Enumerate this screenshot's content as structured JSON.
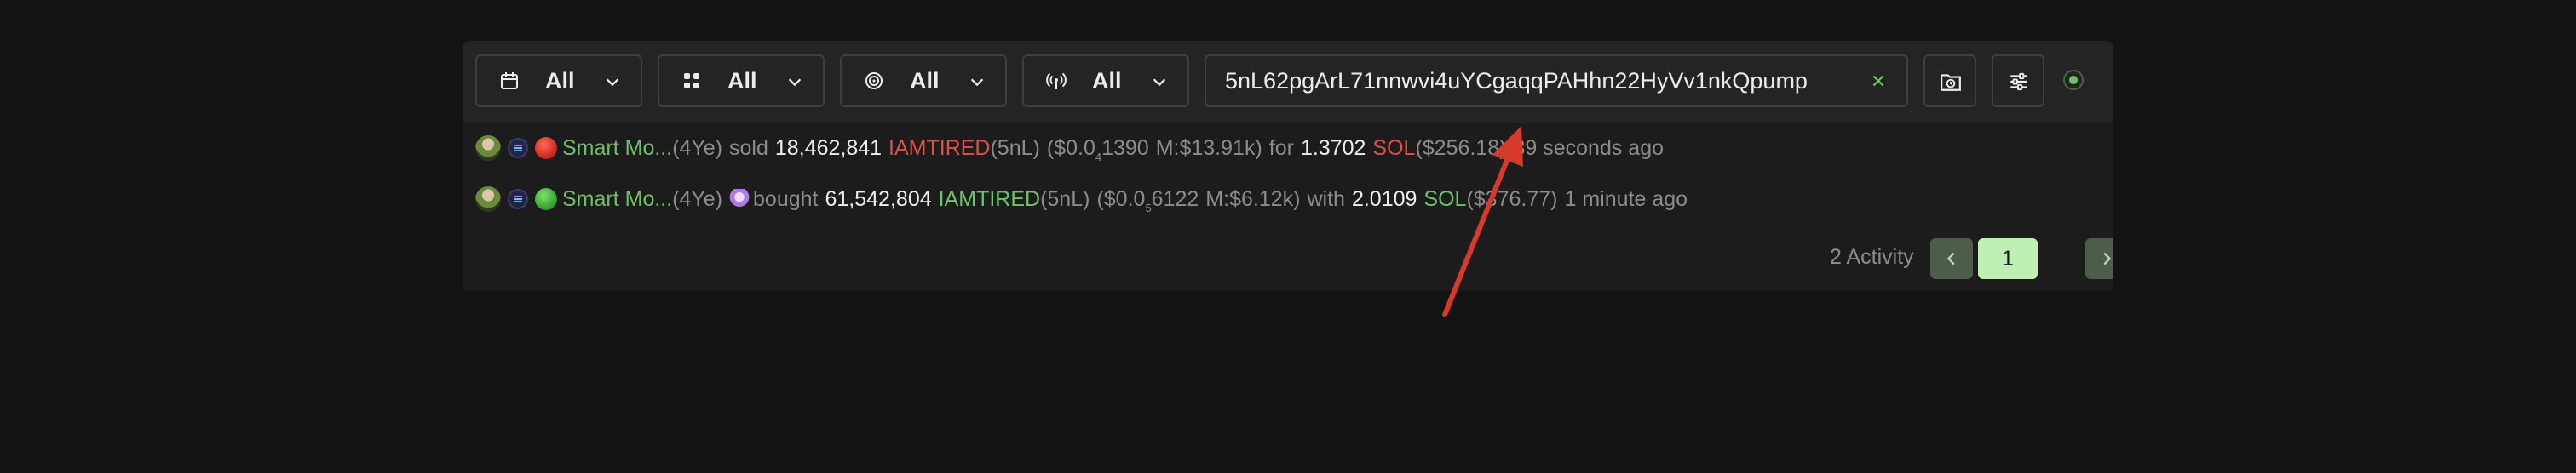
{
  "filters": [
    {
      "icon": "calendar-icon",
      "label": "All"
    },
    {
      "icon": "grid-icon",
      "label": "All"
    },
    {
      "icon": "target-icon",
      "label": "All"
    },
    {
      "icon": "broadcast-icon",
      "label": "All"
    }
  ],
  "search": {
    "value": "5nL62pgArL71nnwvi4uYCgaqqPAHhn22HyVv1nkQpump"
  },
  "activities": [
    {
      "side": "sold",
      "wallet_name": "Smart Mo...",
      "wallet_short": "(4Ye)",
      "action": "sold",
      "amount": "18,462,841",
      "token": "IAMTIRED",
      "token_short": "(5nL)",
      "price_prefix": "($0.0",
      "price_zeros": "4",
      "price_digits": "1390",
      "mcap": "M:$13.91k)",
      "preposition": "for",
      "sol_amount": "1.3702",
      "sol_label": "SOL",
      "usd_value": "($256.18)",
      "time_ago": "39 seconds ago"
    },
    {
      "side": "bought",
      "wallet_name": "Smart Mo...",
      "wallet_short": "(4Ye)",
      "action": "bought",
      "amount": "61,542,804",
      "token": "IAMTIRED",
      "token_short": "(5nL)",
      "price_prefix": "($0.0",
      "price_zeros": "5",
      "price_digits": "6122",
      "mcap": "M:$6.12k)",
      "preposition": "with",
      "sol_amount": "2.0109",
      "sol_label": "SOL",
      "usd_value": "($376.77)",
      "time_ago": "1 minute ago"
    }
  ],
  "pagination": {
    "count_label": "2 Activity",
    "current_page": "1"
  },
  "colors": {
    "sell": "#e0504a",
    "buy": "#6cc46a",
    "annotation_arrow": "#d63a2a"
  }
}
